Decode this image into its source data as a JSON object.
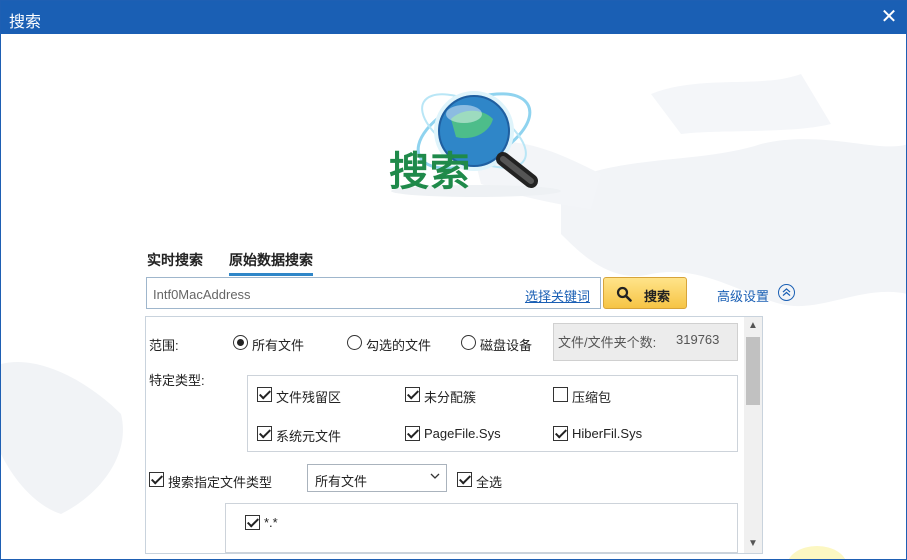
{
  "window": {
    "title": "搜索",
    "close_glyph": "✕"
  },
  "logo": {
    "text": "搜索",
    "icon": "magnifier-globe-icon"
  },
  "tabs": [
    {
      "label": "实时搜索",
      "active": false
    },
    {
      "label": "原始数据搜索",
      "active": true
    }
  ],
  "search": {
    "value": "Intf0MacAddress",
    "keyword_link": "选择关键词",
    "button_label": "搜索"
  },
  "advanced": {
    "label": "高级设置",
    "toggle_icon": "collapse-up-icon"
  },
  "scope": {
    "label": "范围:",
    "options": [
      {
        "label": "所有文件",
        "selected": true
      },
      {
        "label": "勾选的文件",
        "selected": false
      },
      {
        "label": "磁盘设备",
        "selected": false
      }
    ],
    "count_label": "文件/文件夹个数:",
    "count_value": "319763"
  },
  "special_types": {
    "label": "特定类型:",
    "items": [
      {
        "label": "文件残留区",
        "checked": true
      },
      {
        "label": "未分配簇",
        "checked": true
      },
      {
        "label": "压缩包",
        "checked": false
      },
      {
        "label": "系统元文件",
        "checked": true
      },
      {
        "label": "PageFile.Sys",
        "checked": true
      },
      {
        "label": "HiberFil.Sys",
        "checked": true
      }
    ]
  },
  "file_type_filter": {
    "label": "搜索指定文件类型",
    "checked": true,
    "select_value": "所有文件",
    "select_all_label": "全选",
    "select_all_checked": true,
    "extensions": [
      {
        "label": "*.*",
        "checked": true
      }
    ]
  },
  "colors": {
    "titlebar": "#1a5fb4",
    "accent": "#2f86c8",
    "button": "#f6c445",
    "logo_text": "#1f8a4a"
  }
}
